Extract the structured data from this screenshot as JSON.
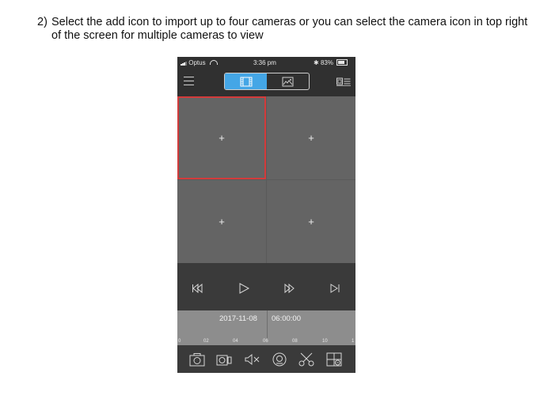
{
  "instruction": {
    "number": "2)",
    "line1": "Select the add icon to import up to four cameras or you can select the camera icon in top right",
    "line2": "of the screen for multiple cameras to view"
  },
  "status_bar": {
    "carrier": "Optus",
    "time": "3:36 pm",
    "battery": "83%"
  },
  "camera_grid": {
    "cells": [
      {
        "label": "+",
        "selected": true
      },
      {
        "label": "+",
        "selected": false
      },
      {
        "label": "+",
        "selected": false
      },
      {
        "label": "+",
        "selected": false
      }
    ],
    "highlight_color": "#d33b3b"
  },
  "timeline": {
    "date": "2017-11-08",
    "time": "06:00:00",
    "ticks": [
      "0",
      "02",
      "04",
      "06",
      "08",
      "10",
      "1"
    ]
  },
  "colors": {
    "accent": "#44a6e6",
    "background": "#3a3a3a"
  },
  "icons": {
    "menu": "menu-icon",
    "video_mode": "film-icon",
    "image_mode": "image-icon",
    "multi_camera": "multi-camera-icon",
    "rewind": "rewind-icon",
    "play": "play-icon",
    "fast_forward": "fast-forward-icon",
    "next_frame": "next-frame-icon",
    "snapshot": "camera-icon",
    "record": "video-record-icon",
    "mute": "mute-icon",
    "playback_search": "search-playback-icon",
    "clip": "scissors-icon",
    "layout": "layout-grid-icon"
  }
}
